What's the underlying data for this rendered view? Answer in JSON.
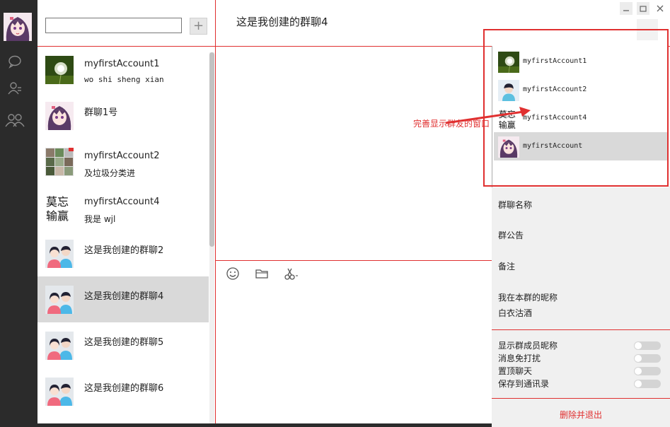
{
  "sidebar": {
    "icons": [
      "chat-icon",
      "contact-icon",
      "group-icon"
    ]
  },
  "contacts": {
    "add_label": "+",
    "search_value": "",
    "items": [
      {
        "name": "myfirstAccount1",
        "message": "wo shi sheng xian",
        "avatar": "dandelion",
        "mono": true
      },
      {
        "name": "群聊1号",
        "message": "",
        "avatar": "anime",
        "mono": false
      },
      {
        "name": "myfirstAccount2",
        "message": "及垃圾分类进",
        "avatar": "collage",
        "mono": false
      },
      {
        "name": "myfirstAccount4",
        "message": "我是 wjl",
        "avatar": "calligraphy",
        "mono": false
      },
      {
        "name": "这是我创建的群聊2",
        "message": "",
        "avatar": "couple",
        "mono": false
      },
      {
        "name": "这是我创建的群聊4",
        "message": "",
        "avatar": "couple",
        "mono": false,
        "active": true
      },
      {
        "name": "这是我创建的群聊5",
        "message": "",
        "avatar": "couple",
        "mono": false
      },
      {
        "name": "这是我创建的群聊6",
        "message": "",
        "avatar": "couple",
        "mono": false
      }
    ]
  },
  "chat": {
    "title": "这是我创建的群聊4",
    "toolbar_icons": [
      "emoji-icon",
      "folder-icon",
      "scissors-icon"
    ]
  },
  "members_popup": {
    "members": [
      {
        "name": "myfirstAccount1",
        "avatar": "dandelion"
      },
      {
        "name": "myfirstAccount2",
        "avatar": "person"
      },
      {
        "name": "myfirstAccount4",
        "avatar": "calligraphy"
      },
      {
        "name": "myfirstAccount",
        "avatar": "anime",
        "selected": true
      }
    ]
  },
  "annotation": "完善显示群友的窗口",
  "group_panel": {
    "name_label": "群聊名称",
    "notice_label": "群公告",
    "remark_label": "备注",
    "nickname_label": "我在本群的昵称",
    "nickname_value": "白衣沽酒",
    "toggles": [
      {
        "label": "显示群成员昵称",
        "on": false
      },
      {
        "label": "消息免打扰",
        "on": false
      },
      {
        "label": "置顶聊天",
        "on": false
      },
      {
        "label": "保存到通讯录",
        "on": false
      }
    ],
    "exit_label": "删除并退出"
  },
  "colors": {
    "accent": "#e03030",
    "sidebar": "#2b2b2b",
    "selected": "#d9d9d9",
    "panel": "#f0f0f0"
  }
}
